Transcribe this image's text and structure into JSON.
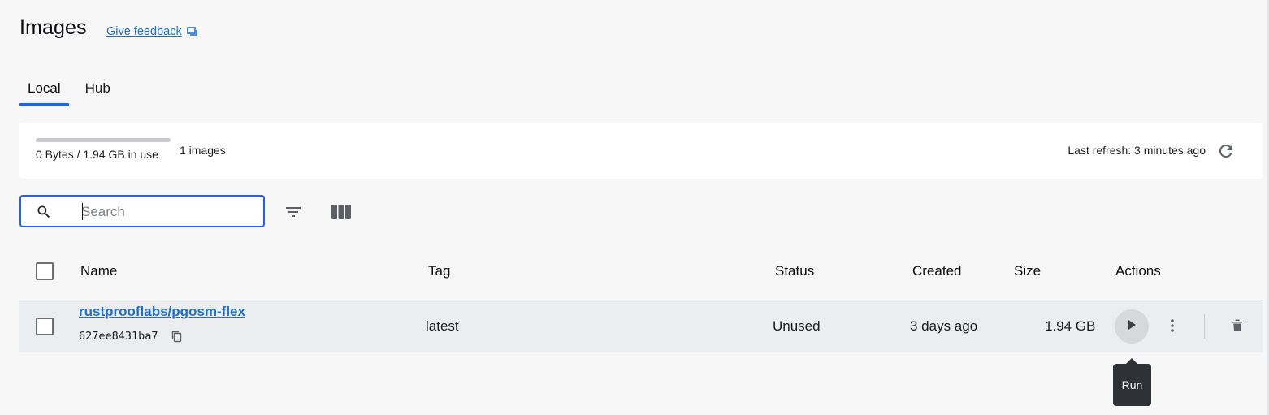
{
  "header": {
    "title": "Images",
    "feedback_label": "Give feedback",
    "feedback_icon": "feedback-icon"
  },
  "tabs": [
    {
      "label": "Local",
      "active": true
    },
    {
      "label": "Hub",
      "active": false
    }
  ],
  "storage": {
    "usage_text": "0 Bytes / 1.94 GB in use",
    "usage_fraction": 0.0,
    "images_count": "1 images",
    "last_refresh": "Last refresh: 3 minutes ago",
    "refresh_icon": "refresh-icon"
  },
  "search": {
    "placeholder": "Search",
    "value": "",
    "search_icon": "search-icon",
    "filter_icon": "filter-icon",
    "columns_icon": "columns-icon"
  },
  "table": {
    "columns": [
      "Name",
      "Tag",
      "Status",
      "Created",
      "Size",
      "Actions"
    ],
    "rows": [
      {
        "name": "rustprooflabs/pgosm-flex",
        "id": "627ee8431ba7",
        "tag": "latest",
        "status": "Unused",
        "created": "3 days ago",
        "size": "1.94 GB"
      }
    ]
  },
  "tooltip": {
    "label": "Run"
  },
  "colors": {
    "accent": "#1d63ed",
    "link": "#1f6fd1",
    "row_highlight": "#ebedef",
    "tooltip_bg": "#2e3135"
  }
}
